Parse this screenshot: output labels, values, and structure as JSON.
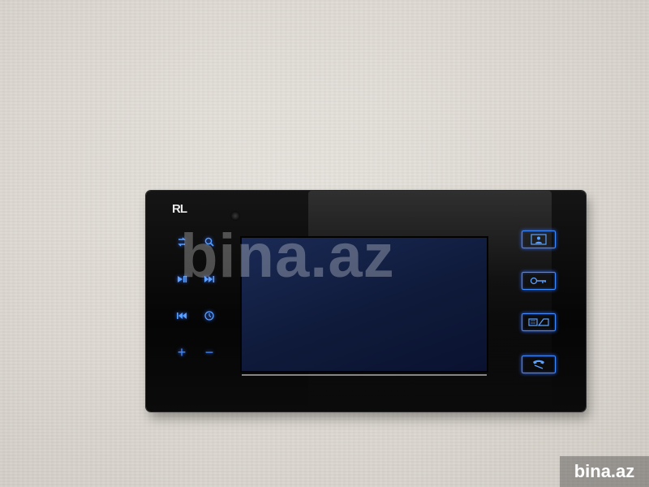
{
  "device": {
    "brand_logo": "RL",
    "left_controls": {
      "row1": [
        "swap-icon",
        "search-icon"
      ],
      "row2": [
        "play-pause-icon",
        "fast-forward-icon"
      ],
      "row3": [
        "rewind-icon",
        "clock-icon"
      ],
      "row4": {
        "plus": "+",
        "minus": "−"
      }
    },
    "right_buttons": [
      "monitor-person-icon",
      "unlock-key-icon",
      "gate-open-icon",
      "phone-handset-icon"
    ],
    "accent_color": "#3f8cff"
  },
  "watermark": {
    "center": "bina.az",
    "corner": "bina.az"
  }
}
